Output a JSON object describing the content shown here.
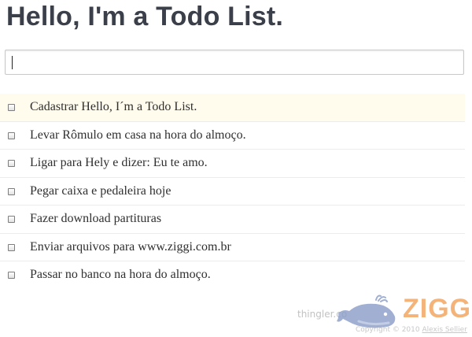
{
  "app": {
    "title": "Hello, I'm a Todo List."
  },
  "input": {
    "value": "",
    "placeholder": ""
  },
  "todos": [
    {
      "label": "Cadastrar Hello, I´m a Todo List.",
      "checked": false,
      "highlighted": true
    },
    {
      "label": "Levar Rômulo em casa na hora do almoço.",
      "checked": false,
      "highlighted": false
    },
    {
      "label": "Ligar para Hely e dizer: Eu te amo.",
      "checked": false,
      "highlighted": false
    },
    {
      "label": "Pegar caixa e pedaleira hoje",
      "checked": false,
      "highlighted": false
    },
    {
      "label": "Fazer download partituras",
      "checked": false,
      "highlighted": false
    },
    {
      "label": "Enviar arquivos para www.ziggi.com.br",
      "checked": false,
      "highlighted": false
    },
    {
      "label": "Passar no banco na hora do almoço.",
      "checked": false,
      "highlighted": false
    }
  ],
  "footer": {
    "link_text": "thingler.co",
    "copyright_prefix": "Copyright © 2010",
    "author": "Alexis Sellier"
  },
  "watermark": {
    "brand": "ZIGG",
    "icon": "whale-icon"
  },
  "colors": {
    "title": "#3a3f4a",
    "highlight_row": "#fffbed",
    "watermark_accent": "#f2a35c",
    "watermark_whale": "#8d9fc9"
  }
}
